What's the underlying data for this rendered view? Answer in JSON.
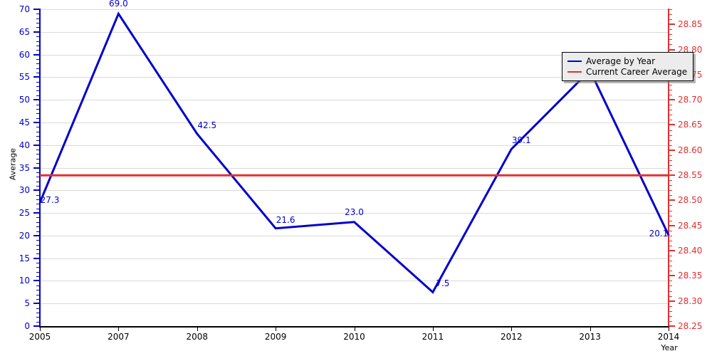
{
  "chart_data": {
    "type": "line",
    "title": "",
    "xlabel": "Year",
    "ylabel": "Average",
    "grid": true,
    "legend_position": "top-right",
    "x": [
      2005,
      2007,
      2008,
      2009,
      2010,
      2011,
      2012,
      2013,
      2014
    ],
    "x_tick_labels": [
      "2005",
      "2007",
      "2008",
      "2009",
      "2010",
      "2011",
      "2012",
      "2013",
      "2014"
    ],
    "left_axis": {
      "label": "Average",
      "color": "#0000cc",
      "ylim": [
        0,
        70
      ],
      "ticks": [
        0,
        5,
        10,
        15,
        20,
        25,
        30,
        35,
        40,
        45,
        50,
        55,
        60,
        65,
        70
      ],
      "tick_labels": [
        "0",
        "5",
        "10",
        "15",
        "20",
        "25",
        "30",
        "35",
        "40",
        "45",
        "50",
        "55",
        "60",
        "65",
        "70"
      ]
    },
    "right_axis": {
      "label": "",
      "color": "#e03030",
      "ylim": [
        28.25,
        28.88
      ],
      "ticks": [
        28.25,
        28.3,
        28.35,
        28.4,
        28.45,
        28.5,
        28.55,
        28.6,
        28.65,
        28.7,
        28.75,
        28.8,
        28.85
      ],
      "tick_labels": [
        "28.25",
        "28.30",
        "28.35",
        "28.40",
        "28.45",
        "28.50",
        "28.55",
        "28.60",
        "28.65",
        "28.70",
        "28.75",
        "28.80",
        "28.85"
      ]
    },
    "series": [
      {
        "name": "Average by Year",
        "color": "#0000cc",
        "axis": "left",
        "values": [
          27.3,
          69.0,
          42.5,
          21.6,
          23.0,
          7.5,
          39.1,
          56.5,
          20.1
        ],
        "point_labels": [
          "27.3",
          "69.0",
          "42.5",
          "21.6",
          "23.0",
          "7.5",
          "39.1",
          "",
          "20.1"
        ]
      },
      {
        "name": "Current Career Average",
        "color": "#e03030",
        "axis": "left",
        "type": "hline",
        "value": 33.3
      }
    ]
  },
  "legend": {
    "items": [
      {
        "label": "Average by Year",
        "color": "#0000cc"
      },
      {
        "label": "Current Career Average",
        "color": "#e03030"
      }
    ]
  }
}
